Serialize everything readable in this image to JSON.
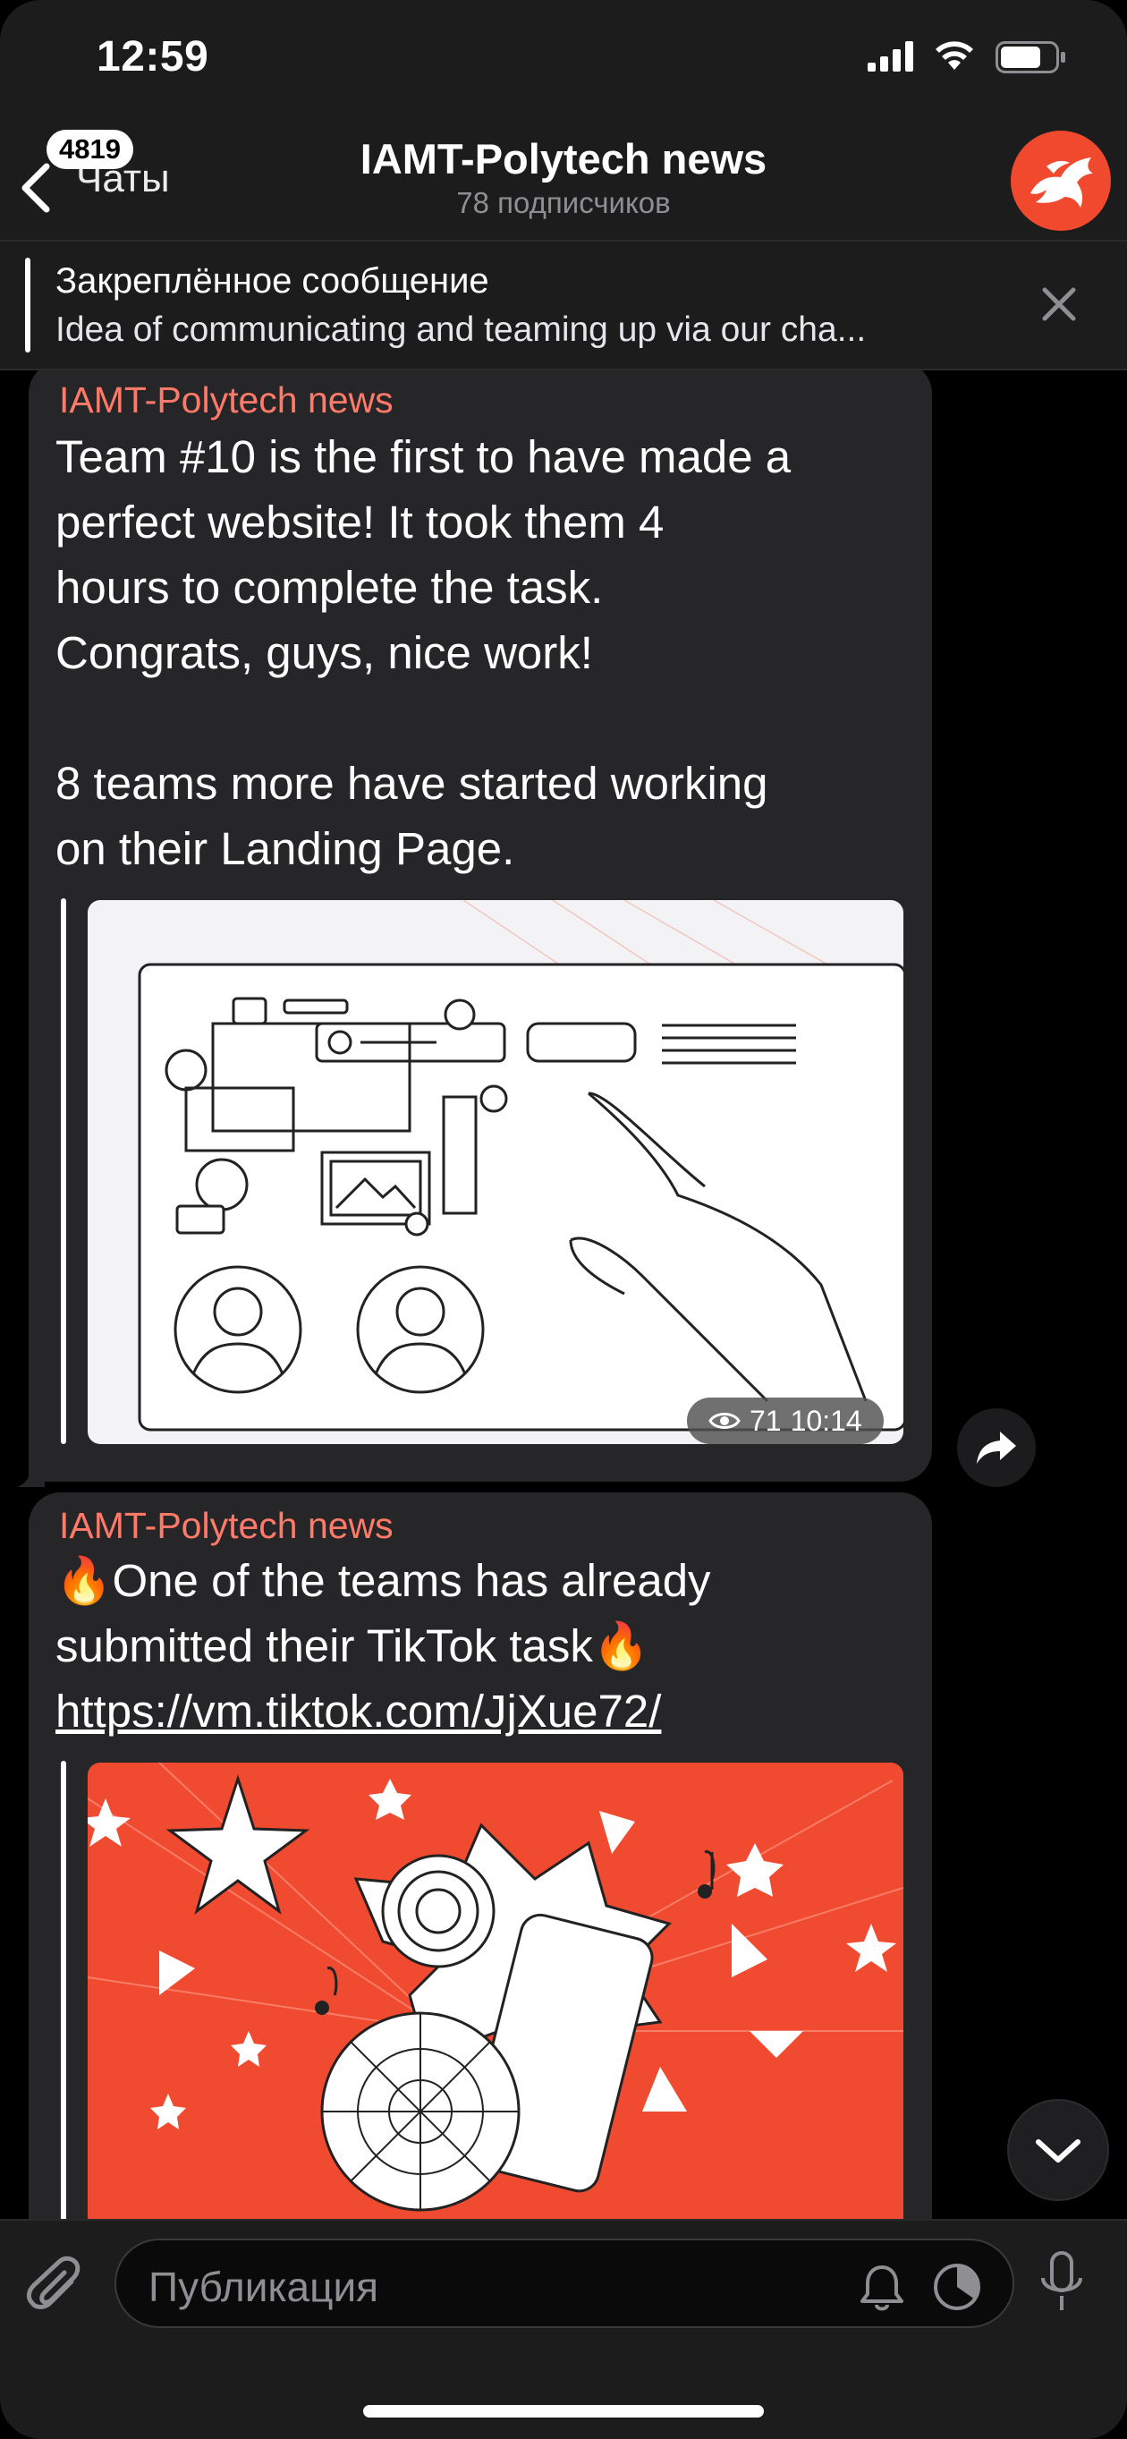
{
  "status_bar": {
    "time": "12:59"
  },
  "nav": {
    "unread_count": "4819",
    "back_label": "Чаты",
    "title": "IAMT-Polytech news",
    "subtitle": "78 подписчиков"
  },
  "pinned": {
    "title": "Закреплённое сообщение",
    "text": "Idea of communicating and teaming up via our cha..."
  },
  "messages": [
    {
      "sender": "IAMT-Polytech news",
      "text": "Team #10 is the first to have made a\nperfect website! It took them 4\nhours to complete the task.\nCongrats, guys, nice work!\n\n8 teams more have started working\non their Landing Page.",
      "views": "71",
      "time": "10:14"
    },
    {
      "sender": "IAMT-Polytech news",
      "text": "🔥One of the teams has already\nsubmitted their TikTok task🔥",
      "link": "https://vm.tiktok.com/JjXue72/"
    }
  ],
  "input": {
    "placeholder": "Публикация"
  },
  "colors": {
    "accent_sender": "#ff7a68",
    "avatar_bg": "#f0492e",
    "preview2_bg": "#f04b31"
  }
}
